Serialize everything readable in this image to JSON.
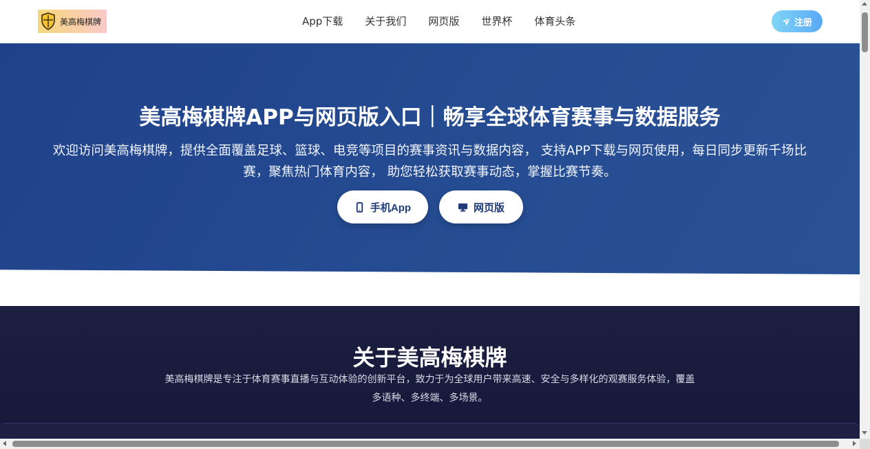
{
  "header": {
    "logo_text": "美高梅棋牌",
    "nav": [
      "App下载",
      "关于我们",
      "网页版",
      "世界杯",
      "体育头条"
    ],
    "register_label": "注册"
  },
  "hero": {
    "title": "美高梅棋牌APP与网页版入口｜畅享全球体育赛事与数据服务",
    "description": "欢迎访问美高梅棋牌，提供全面覆盖足球、篮球、电竞等项目的赛事资讯与数据内容， 支持APP下载与网页使用，每日同步更新千场比赛，聚焦热门体育内容， 助您轻松获取赛事动态，掌握比赛节奏。",
    "app_button": "手机App",
    "web_button": "网页版"
  },
  "about": {
    "title": "关于美高梅棋牌",
    "description": "美高梅棋牌是专注于体育赛事直播与互动体验的创新平台，致力于为全球用户带来高速、安全与多样化的观赛服务体验，覆盖多语种、多终端、多场景。"
  },
  "colors": {
    "hero_bg": "#244a8f",
    "about_bg": "#1a1d3e",
    "register_gradient_start": "#7fd6f7",
    "register_gradient_end": "#5aa8f5",
    "hero_button_text": "#1f3d7a"
  },
  "icons": {
    "logo": "shield-logo-icon",
    "register": "paper-plane-icon",
    "app_button": "mobile-phone-icon",
    "web_button": "desktop-monitor-icon"
  }
}
